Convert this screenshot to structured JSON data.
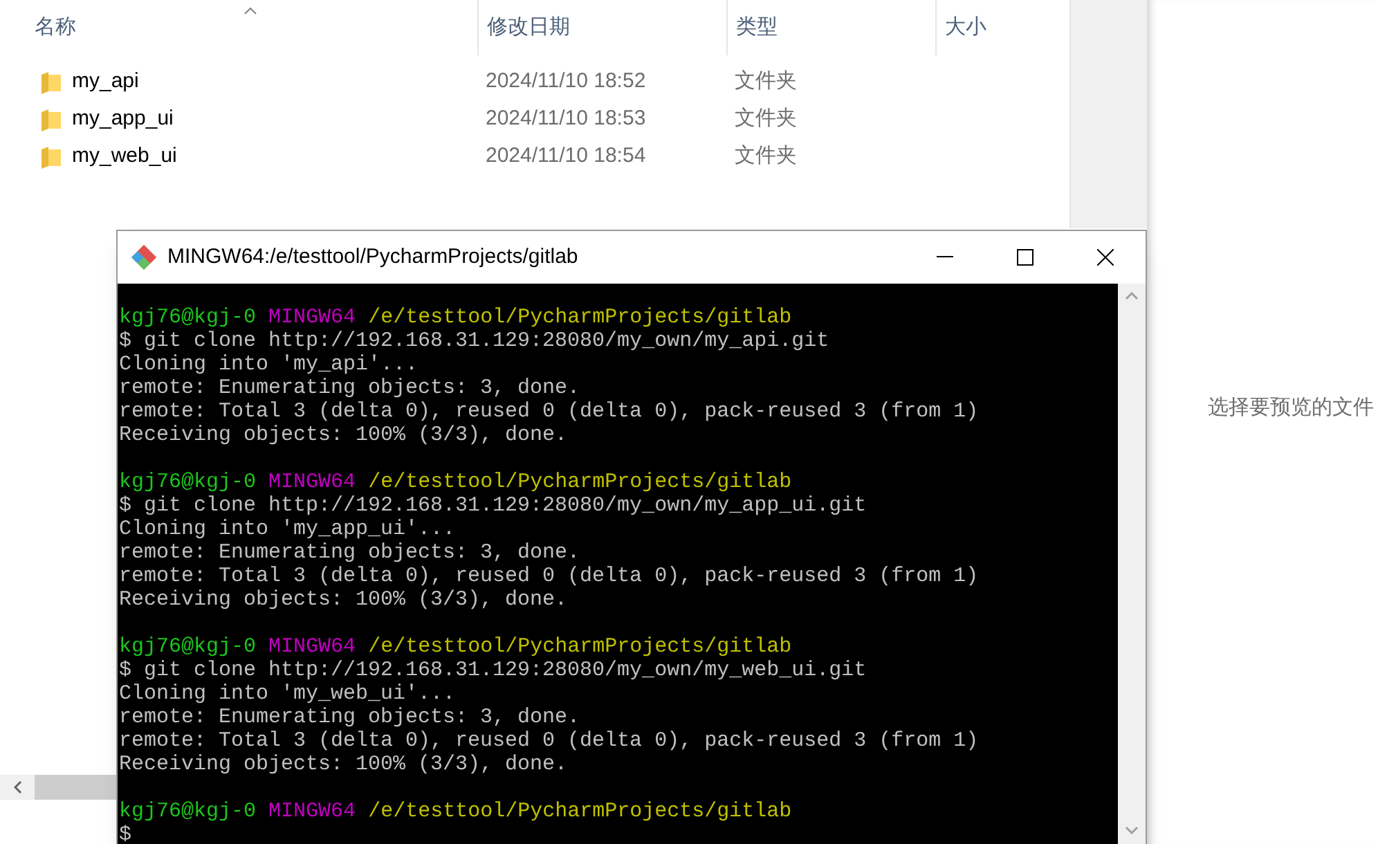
{
  "explorer": {
    "columns": [
      {
        "label": "名称",
        "sorted": true
      },
      {
        "label": "修改日期",
        "sorted": false
      },
      {
        "label": "类型",
        "sorted": false
      },
      {
        "label": "大小",
        "sorted": false
      }
    ],
    "rows": [
      {
        "name": "my_api",
        "modified": "2024/11/10 18:52",
        "type": "文件夹"
      },
      {
        "name": "my_app_ui",
        "modified": "2024/11/10 18:53",
        "type": "文件夹"
      },
      {
        "name": "my_web_ui",
        "modified": "2024/11/10 18:54",
        "type": "文件夹"
      }
    ],
    "preview_message": "选择要预览的文件"
  },
  "terminal": {
    "title": "MINGW64:/e/testtool/PycharmProjects/gitlab",
    "lines": [
      {
        "kind": "prompt",
        "user": "kgj76@kgj-0",
        "shell": "MINGW64",
        "path": "/e/testtool/PycharmProjects/gitlab"
      },
      {
        "kind": "output",
        "text": "$ git clone http://192.168.31.129:28080/my_own/my_api.git"
      },
      {
        "kind": "output",
        "text": "Cloning into 'my_api'..."
      },
      {
        "kind": "output",
        "text": "remote: Enumerating objects: 3, done."
      },
      {
        "kind": "output",
        "text": "remote: Total 3 (delta 0), reused 0 (delta 0), pack-reused 3 (from 1)"
      },
      {
        "kind": "output",
        "text": "Receiving objects: 100% (3/3), done."
      },
      {
        "kind": "blank"
      },
      {
        "kind": "prompt",
        "user": "kgj76@kgj-0",
        "shell": "MINGW64",
        "path": "/e/testtool/PycharmProjects/gitlab"
      },
      {
        "kind": "output",
        "text": "$ git clone http://192.168.31.129:28080/my_own/my_app_ui.git"
      },
      {
        "kind": "output",
        "text": "Cloning into 'my_app_ui'..."
      },
      {
        "kind": "output",
        "text": "remote: Enumerating objects: 3, done."
      },
      {
        "kind": "output",
        "text": "remote: Total 3 (delta 0), reused 0 (delta 0), pack-reused 3 (from 1)"
      },
      {
        "kind": "output",
        "text": "Receiving objects: 100% (3/3), done."
      },
      {
        "kind": "blank"
      },
      {
        "kind": "prompt",
        "user": "kgj76@kgj-0",
        "shell": "MINGW64",
        "path": "/e/testtool/PycharmProjects/gitlab"
      },
      {
        "kind": "output",
        "text": "$ git clone http://192.168.31.129:28080/my_own/my_web_ui.git"
      },
      {
        "kind": "output",
        "text": "Cloning into 'my_web_ui'..."
      },
      {
        "kind": "output",
        "text": "remote: Enumerating objects: 3, done."
      },
      {
        "kind": "output",
        "text": "remote: Total 3 (delta 0), reused 0 (delta 0), pack-reused 3 (from 1)"
      },
      {
        "kind": "output",
        "text": "Receiving objects: 100% (3/3), done."
      },
      {
        "kind": "blank"
      },
      {
        "kind": "prompt",
        "user": "kgj76@kgj-0",
        "shell": "MINGW64",
        "path": "/e/testtool/PycharmProjects/gitlab"
      },
      {
        "kind": "output",
        "text": "$"
      }
    ]
  }
}
